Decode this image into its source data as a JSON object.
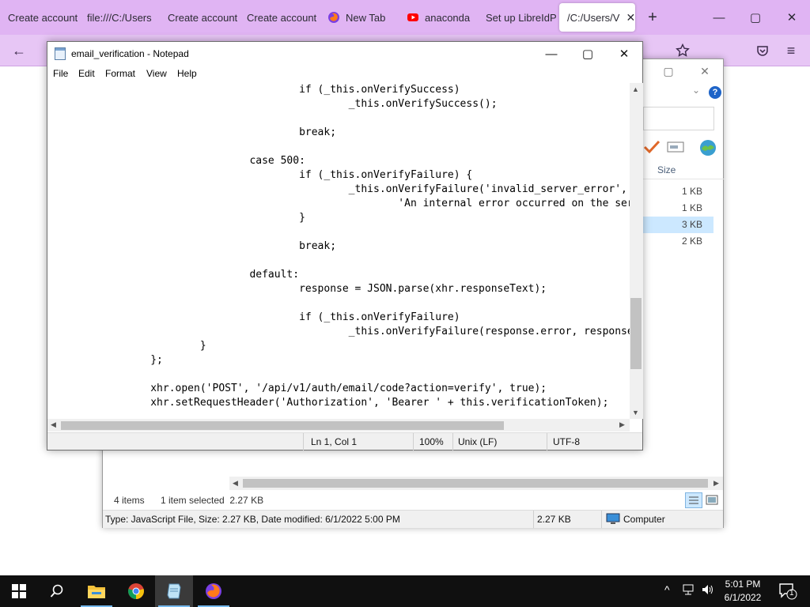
{
  "browser": {
    "tabs": [
      {
        "label": "Create account",
        "icon": "none"
      },
      {
        "label": "file:///C:/Users",
        "icon": "none"
      },
      {
        "label": "Create account",
        "icon": "none"
      },
      {
        "label": "Create account",
        "icon": "none"
      },
      {
        "label": "New Tab",
        "icon": "firefox-icon"
      },
      {
        "label": "anaconda",
        "icon": "youtube-icon"
      },
      {
        "label": "Set up LibreIdP",
        "icon": "none"
      },
      {
        "label": "/C:/Users/V",
        "icon": "none",
        "active": true
      }
    ],
    "new_tab": "+",
    "window_controls": {
      "minimize": "—",
      "maximize": "▢",
      "close": "✕"
    },
    "colors": {
      "tabbar": "#e0b4f3",
      "navbar": "#e7c6f5"
    }
  },
  "explorer": {
    "size_header": "Size",
    "sizes": [
      "1 KB",
      "1 KB",
      "3 KB",
      "2 KB"
    ],
    "selected_index": 2,
    "items_count": "4 items",
    "selected_info": "1 item selected  2.27 KB",
    "details": "Type: JavaScript File, Size: 2.27 KB, Date modified: 6/1/2022 5:00 PM",
    "details_size": "2.27 KB",
    "location": "Computer",
    "help": "?"
  },
  "notepad": {
    "title": "email_verification - Notepad",
    "menu": [
      "File",
      "Edit",
      "Format",
      "View",
      "Help"
    ],
    "code_lines": [
      "                                        if (_this.onVerifySuccess)",
      "                                                _this.onVerifySuccess();",
      "",
      "                                        break;",
      "",
      "                                case 500:",
      "                                        if (_this.onVerifyFailure) {",
      "                                                _this.onVerifyFailure('invalid_server_error',",
      "                                                        'An internal error occurred on the server.');",
      "                                        }",
      "",
      "                                        break;",
      "",
      "                                default:",
      "                                        response = JSON.parse(xhr.responseText);",
      "",
      "                                        if (_this.onVerifyFailure)",
      "                                                _this.onVerifyFailure(response.error, response.message);",
      "                        }",
      "                };",
      "",
      "                xhr.open('POST', '/api/v1/auth/email/code?action=verify', true);",
      "                xhr.setRequestHeader('Authorization', 'Bearer ' + this.verificationToken);"
    ],
    "status": {
      "position": "Ln 1, Col 1",
      "zoom": "100%",
      "line_endings": "Unix (LF)",
      "encoding": "UTF-8"
    }
  },
  "taskbar": {
    "apps": [
      "start-icon",
      "search-icon",
      "file-explorer-icon",
      "chrome-icon",
      "notepad-icon",
      "firefox-icon"
    ],
    "time": "5:01 PM",
    "date": "6/1/2022",
    "notification_count": "1"
  }
}
